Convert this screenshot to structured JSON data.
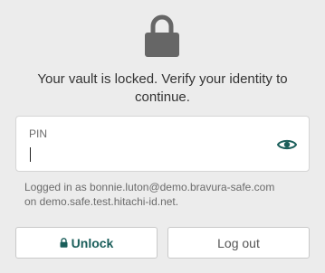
{
  "lock": {
    "icon": "lock-icon",
    "color": "#666666"
  },
  "message": {
    "line1": "Your vault is locked. Verify your identity to",
    "line2": "continue."
  },
  "pin": {
    "label": "PIN",
    "value": "",
    "toggle_icon": "eye-icon",
    "accent_color": "#1a5e5a"
  },
  "hint": {
    "line1": "Logged in as bonnie.luton@demo.bravura-safe.com",
    "line2": "on demo.safe.test.hitachi-id.net."
  },
  "buttons": {
    "unlock_label": "Unlock",
    "unlock_icon": "lock-icon",
    "logout_label": "Log out"
  }
}
